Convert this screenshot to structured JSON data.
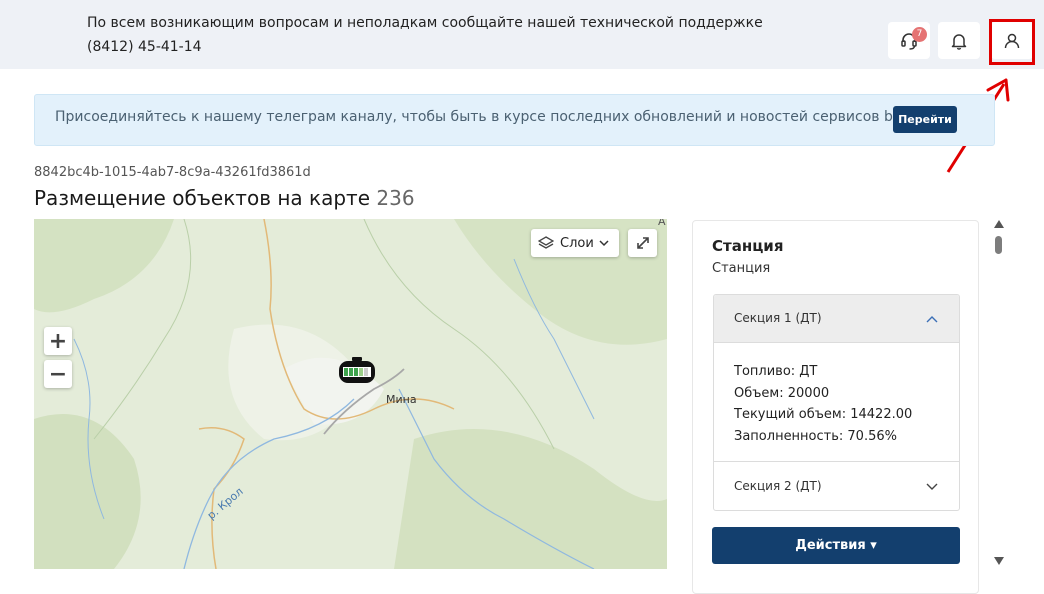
{
  "header": {
    "notice": "По всем возникающим вопросам и неполадкам сообщайте нашей технической поддержке (8412) 45-41-14",
    "support_badge": "7"
  },
  "banner": {
    "text": "Присоединяйтесь к нашему телеграм каналу, чтобы быть в курсе последних обновлений и новостей сервисов benzamat",
    "button_label": "Перейти"
  },
  "page": {
    "uuid": "8842bc4b-1015-4ab7-8c9a-43261fd3861d",
    "title": "Размещение объектов на карте",
    "count": "236"
  },
  "map": {
    "layers_label": "Слои",
    "zoom_in": "+",
    "zoom_out": "−",
    "place_label": "Мина",
    "river_label": "р. Крол",
    "edge_label": "А"
  },
  "panel": {
    "title": "Станция",
    "subtitle": "Станция",
    "sections": [
      {
        "label": "Секция 1 (ДТ)",
        "expanded": true,
        "fields": [
          "Топливо: ДТ",
          "Объем: 20000",
          "Текущий объем: 14422.00",
          "Заполненность: 70.56%"
        ]
      },
      {
        "label": "Секция 2 (ДТ)",
        "expanded": false
      }
    ],
    "actions_label": "Действия ▾"
  },
  "colors": {
    "primary": "#133f6e",
    "banner_bg": "#e3f1fb",
    "highlight": "#e00000",
    "map_bg": "#e4ecd9"
  }
}
